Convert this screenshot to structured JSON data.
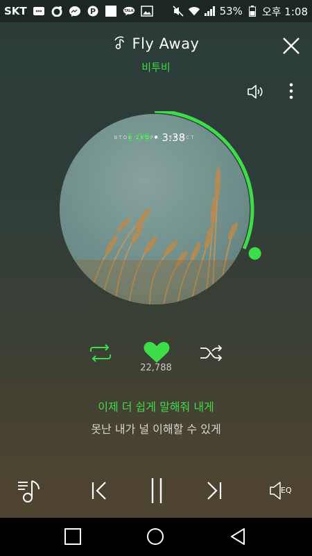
{
  "status_bar": {
    "carrier": "SKT",
    "icons": [
      "message-icon",
      "kakao-story-icon",
      "messenger-icon",
      "p-app-icon",
      "blank-app-icon",
      "talk-icon",
      "gallery-icon"
    ],
    "right_icons": [
      "mute-icon",
      "wifi-icon",
      "signal-icon",
      "battery-icon"
    ],
    "battery": "53%",
    "time": "오후 1:08"
  },
  "player": {
    "title": "Fly Away",
    "artist": "비투비",
    "album_caption": "BTOB ZEOP ... ER ACT",
    "time_current": "1:09",
    "time_separator": "•",
    "time_total": "3:38",
    "progress": 0.316,
    "liked": true,
    "like_count": "22,788",
    "lyric_current": "이제 더 쉽게 말해줘 내게",
    "lyric_next": "못난 내가 널 이해할 수 있게",
    "eq_label": "EQ"
  },
  "colors": {
    "accent": "#3ddc4a",
    "background_top": "#2b3b38",
    "background_bottom": "#4d4530",
    "navbar": "#000000"
  }
}
